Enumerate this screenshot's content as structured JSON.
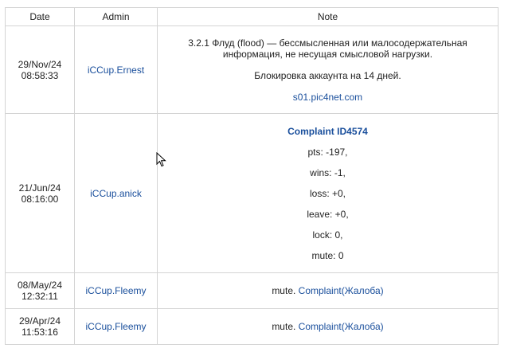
{
  "table": {
    "headers": {
      "date": "Date",
      "admin": "Admin",
      "note": "Note"
    },
    "rows": [
      {
        "date": "29/Nov/24",
        "time": "08:58:33",
        "admin": "iCCup.Ernest",
        "note_line1": "3.2.1 Флуд (flood) — бессмысленная или малосодержательная",
        "note_line2": "информация, не несущая смысловой нагрузки.",
        "note_line3": "Блокировка аккаунта на 14 дней.",
        "note_link": "s01.pic4net.com"
      },
      {
        "date": "21/Jun/24",
        "time": "08:16:00",
        "admin": "iCCup.anick",
        "complaint_title": "Complaint ID4574",
        "stats": [
          "pts: -197,",
          "wins: -1,",
          "loss: +0,",
          "leave: +0,",
          "lock: 0,",
          "mute: 0"
        ]
      },
      {
        "date": "08/May/24",
        "time": "12:32:11",
        "admin": "iCCup.Fleemy",
        "note_prefix": "mute.",
        "note_link": "Complaint(Жалоба)"
      },
      {
        "date": "29/Apr/24",
        "time": "11:53:16",
        "admin": "iCCup.Fleemy",
        "note_prefix": "mute.",
        "note_link": "Complaint(Жалоба)"
      }
    ]
  },
  "colors": {
    "link": "#1a4f9c",
    "border": "#d4d4d4"
  },
  "cursor_icon": "arrow-cursor-icon"
}
